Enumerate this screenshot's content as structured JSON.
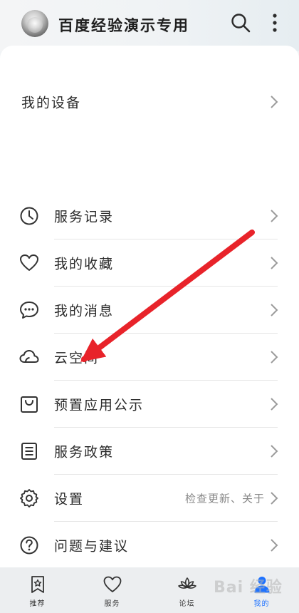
{
  "header": {
    "username": "百度经验演示专用",
    "search_icon": "search-icon",
    "more_icon": "more-vertical-icon"
  },
  "device": {
    "label": "我的设备"
  },
  "menu": {
    "items": [
      {
        "label": "服务记录",
        "icon": "clock-icon"
      },
      {
        "label": "我的收藏",
        "icon": "heart-icon"
      },
      {
        "label": "我的消息",
        "icon": "message-icon"
      },
      {
        "label": "云空间",
        "icon": "cloud-icon"
      },
      {
        "label": "预置应用公示",
        "icon": "shopping-bag-icon"
      },
      {
        "label": "服务政策",
        "icon": "document-list-icon"
      },
      {
        "label": "设置",
        "icon": "gear-icon",
        "extra": "检查更新、关于"
      },
      {
        "label": "问题与建议",
        "icon": "question-icon"
      }
    ]
  },
  "tabs": [
    {
      "label": "推荐",
      "icon": "bookmark-star-icon",
      "active": false
    },
    {
      "label": "服务",
      "icon": "heart-icon",
      "active": false
    },
    {
      "label": "论坛",
      "icon": "lotus-icon",
      "active": false
    },
    {
      "label": "我的",
      "icon": "person-icon",
      "active": true
    }
  ],
  "watermark": "Bai 经验",
  "colors": {
    "accent": "#1e72ff",
    "annotation_arrow": "#e8232a",
    "background": "#f1f4f6"
  }
}
